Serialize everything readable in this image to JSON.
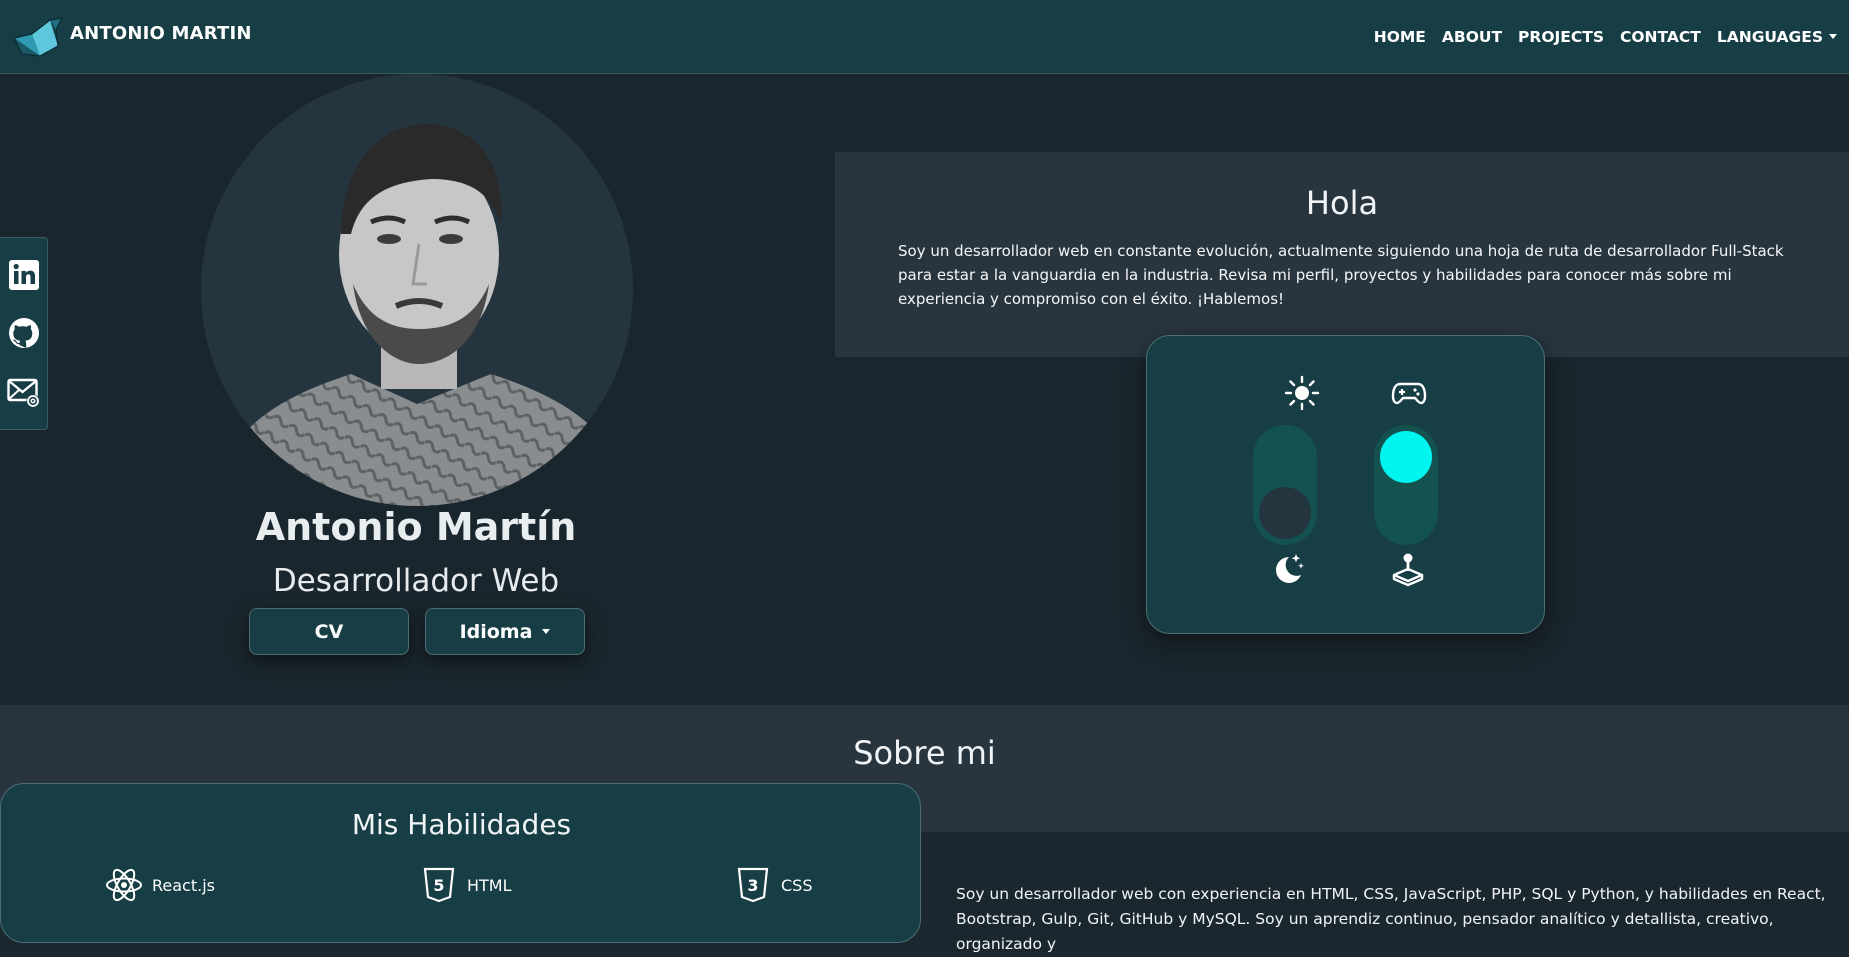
{
  "navbar": {
    "brand": "ANTONIO MARTIN",
    "links": [
      "HOME",
      "ABOUT",
      "PROJECTS",
      "CONTACT"
    ],
    "languages": "LANGUAGES"
  },
  "social": [
    "linkedin-icon",
    "github-icon",
    "email-icon"
  ],
  "profile": {
    "name": "Antonio Martín",
    "role": "Desarrollador Web",
    "cv_button": "CV",
    "language_button": "Idioma"
  },
  "hola": {
    "title": "Hola",
    "text": "Soy un desarrollador web en constante evolución, actualmente siguiendo una hoja de ruta de desarrollador Full-Stack para estar a la vanguardia en la industria. Revisa mi perfil, proyectos y habilidades para conocer más sobre mi experiencia y compromiso con el éxito. ¡Hablemos!"
  },
  "toggles": {
    "theme": {
      "top_icon": "sun-icon",
      "bottom_icon": "moon-icon",
      "state": "dark"
    },
    "mode": {
      "top_icon": "gamepad-icon",
      "bottom_icon": "joystick-icon",
      "state": "game"
    }
  },
  "about": {
    "title": "Sobre mi",
    "skills_title": "Mis Habilidades",
    "skills": [
      "React.js",
      "HTML",
      "CSS"
    ],
    "text": "Soy un desarrollador web con experiencia en HTML, CSS, JavaScript, PHP, SQL y Python, y habilidades en React, Bootstrap, Gulp, Git, GitHub y MySQL. Soy un aprendiz continuo, pensador analítico y detallista, creativo, organizado y"
  },
  "colors": {
    "accent": "#00f5f0",
    "navbar": "#173d45",
    "background": "#1a262d",
    "panel": "#28353f",
    "toggle_track": "#13524e",
    "knob_dark": "#25353f"
  }
}
